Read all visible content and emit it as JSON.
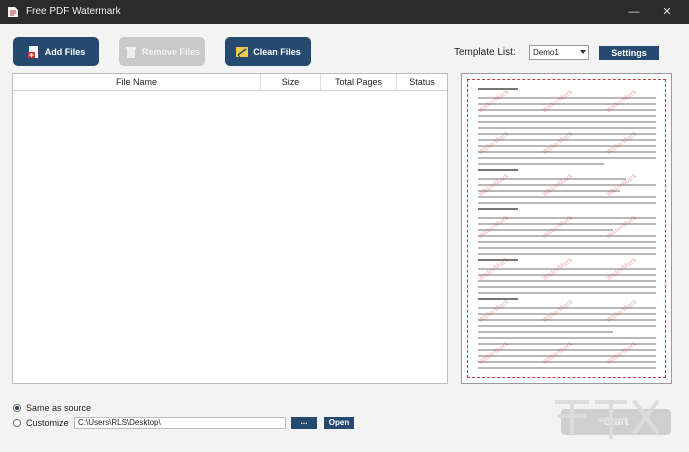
{
  "window": {
    "title": "Free PDF Watermark",
    "minimize": "—",
    "close": "✕"
  },
  "toolbar": {
    "add_files": "Add Files",
    "remove_files": "Remove Files",
    "clean_files": "Clean Files"
  },
  "template": {
    "label": "Template List:",
    "selected": "Demo1",
    "settings": "Settings"
  },
  "table": {
    "columns": [
      "File Name",
      "Size",
      "Total Pages",
      "Status"
    ],
    "rows": []
  },
  "preview": {
    "watermark_text": "WaterMark"
  },
  "output": {
    "same_as_source": "Same as source",
    "customize": "Customize",
    "selected_option": "same_as_source",
    "path": "C:\\Users\\RLS\\Desktop\\",
    "browse": "...",
    "open": "Open"
  },
  "start": "Start",
  "colors": {
    "accent": "#26496f",
    "titlebar": "#2b2b2b",
    "watermark": "#c43b3b",
    "disabled": "#c9c9c9"
  }
}
